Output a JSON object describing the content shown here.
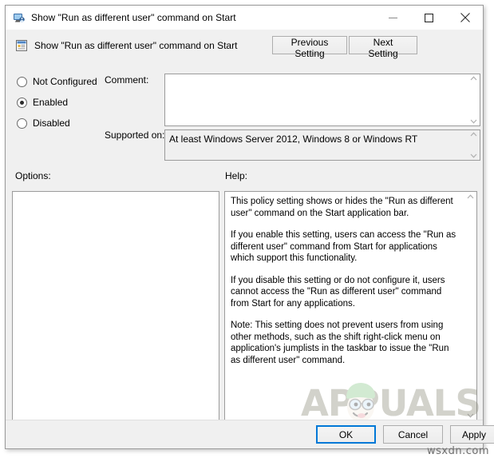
{
  "window": {
    "title": "Show \"Run as different user\" command on Start",
    "icon": "policy-monitor-icon",
    "controls": {
      "minimize": "minimize-icon",
      "maximize": "maximize-icon",
      "close": "close-icon"
    }
  },
  "header": {
    "icon": "policy-setting-icon",
    "title": "Show \"Run as different user\" command on Start",
    "previous_setting": "Previous Setting",
    "next_setting": "Next Setting"
  },
  "state_options": [
    {
      "label": "Not Configured",
      "selected": false
    },
    {
      "label": "Enabled",
      "selected": true
    },
    {
      "label": "Disabled",
      "selected": false
    }
  ],
  "comment": {
    "label": "Comment:",
    "value": "",
    "placeholder": ""
  },
  "supported_on": {
    "label": "Supported on:",
    "value": "At least Windows Server 2012, Windows 8 or Windows RT"
  },
  "options": {
    "label": "Options:",
    "items": []
  },
  "help": {
    "label": "Help:",
    "paragraphs": [
      "This policy setting shows or hides the \"Run as different user\" command on the Start application bar.",
      "If you enable this setting, users can access the \"Run as different user\" command from Start for applications which support this functionality.",
      "If you disable this setting or do not configure it, users cannot access the \"Run as different user\" command from Start for any applications.",
      "Note: This setting does not prevent users from using other methods, such as the shift right-click menu on application's jumplists in the taskbar to issue the \"Run as different user\" command."
    ]
  },
  "footer": {
    "ok": "OK",
    "cancel": "Cancel",
    "apply": "Apply"
  },
  "watermarks": {
    "brand": "APPUALS",
    "site": "wsxdn.com"
  },
  "colors": {
    "window_background": "#f0f0f0",
    "field_background": "#ffffff",
    "border": "#9b9b9b",
    "accent_focus": "#0078d7",
    "text": "#000000"
  }
}
